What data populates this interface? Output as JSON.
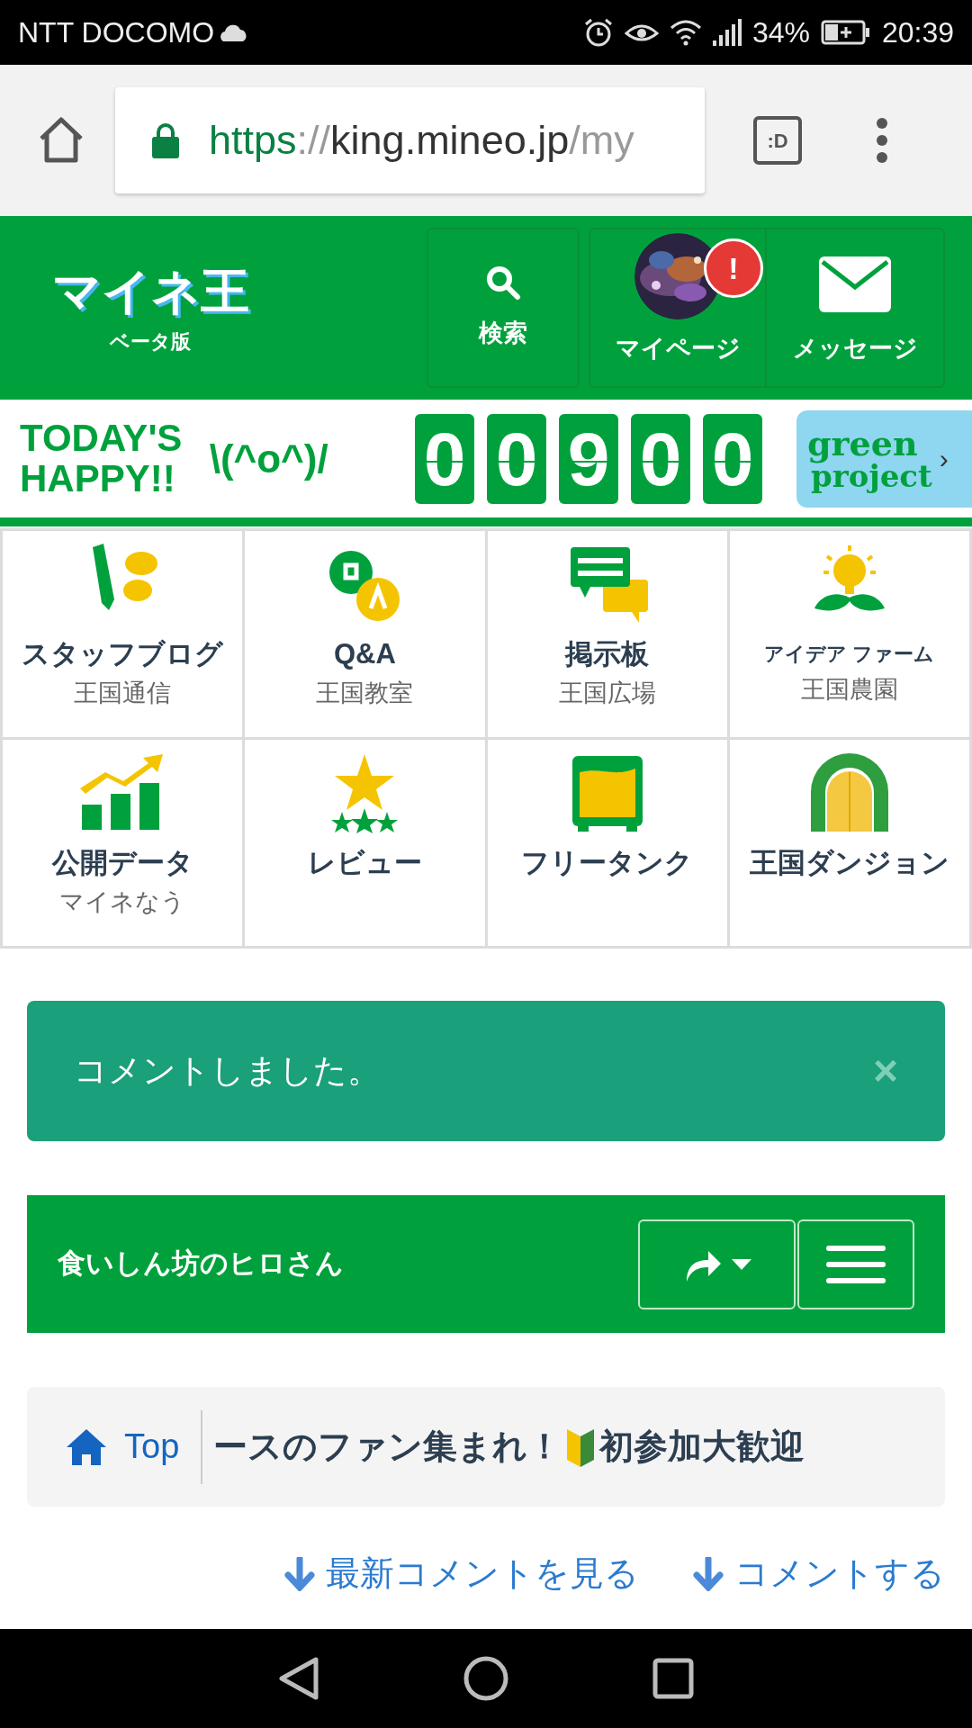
{
  "status_bar": {
    "carrier": "NTT DOCOMO",
    "battery": "34%",
    "time": "20:39"
  },
  "browser": {
    "url": {
      "scheme": "https",
      "separator": "://",
      "host": "king.mineo.jp",
      "path": "/my"
    },
    "tab_label": ":D"
  },
  "header": {
    "logo": "マイネ王",
    "logo_sub": "ベータ版",
    "search": "検索",
    "mypage": "マイページ",
    "mypage_badge": "!",
    "messages": "メッセージ"
  },
  "banner": {
    "line1": "TODAY'S",
    "line2": "HAPPY!!",
    "face": "\\(^o^)/",
    "digits": [
      "0",
      "0",
      "9",
      "0",
      "0"
    ],
    "promo_line1": "green",
    "promo_line2": "project",
    "promo_arrow": "›"
  },
  "menu": [
    {
      "kind": "blog",
      "title": "スタッフブログ",
      "subtitle": "王国通信",
      "small_title": false
    },
    {
      "kind": "qa",
      "title": "Q&A",
      "subtitle": "王国教室",
      "small_title": false
    },
    {
      "kind": "board",
      "title": "掲示板",
      "subtitle": "王国広場",
      "small_title": false
    },
    {
      "kind": "idea",
      "title": "アイデア ファーム",
      "subtitle": "王国農園",
      "small_title": true
    },
    {
      "kind": "data",
      "title": "公開データ",
      "subtitle": "マイネなう",
      "small_title": false
    },
    {
      "kind": "review",
      "title": "レビュー",
      "small_title": false
    },
    {
      "kind": "tank",
      "title": "フリータンク",
      "small_title": false
    },
    {
      "kind": "dungeon",
      "title": "王国ダンジョン",
      "small_title": false
    }
  ],
  "alert": {
    "message": "コメントしました。",
    "close": "×"
  },
  "thread_bar": {
    "title": "食いしん坊のヒロさん"
  },
  "breadcrumb": {
    "home": "Top",
    "current_a": "ースのファン集まれ！",
    "current_b": "初参加大歓迎"
  },
  "links": [
    "最新コメントを見る",
    "コメントする"
  ]
}
